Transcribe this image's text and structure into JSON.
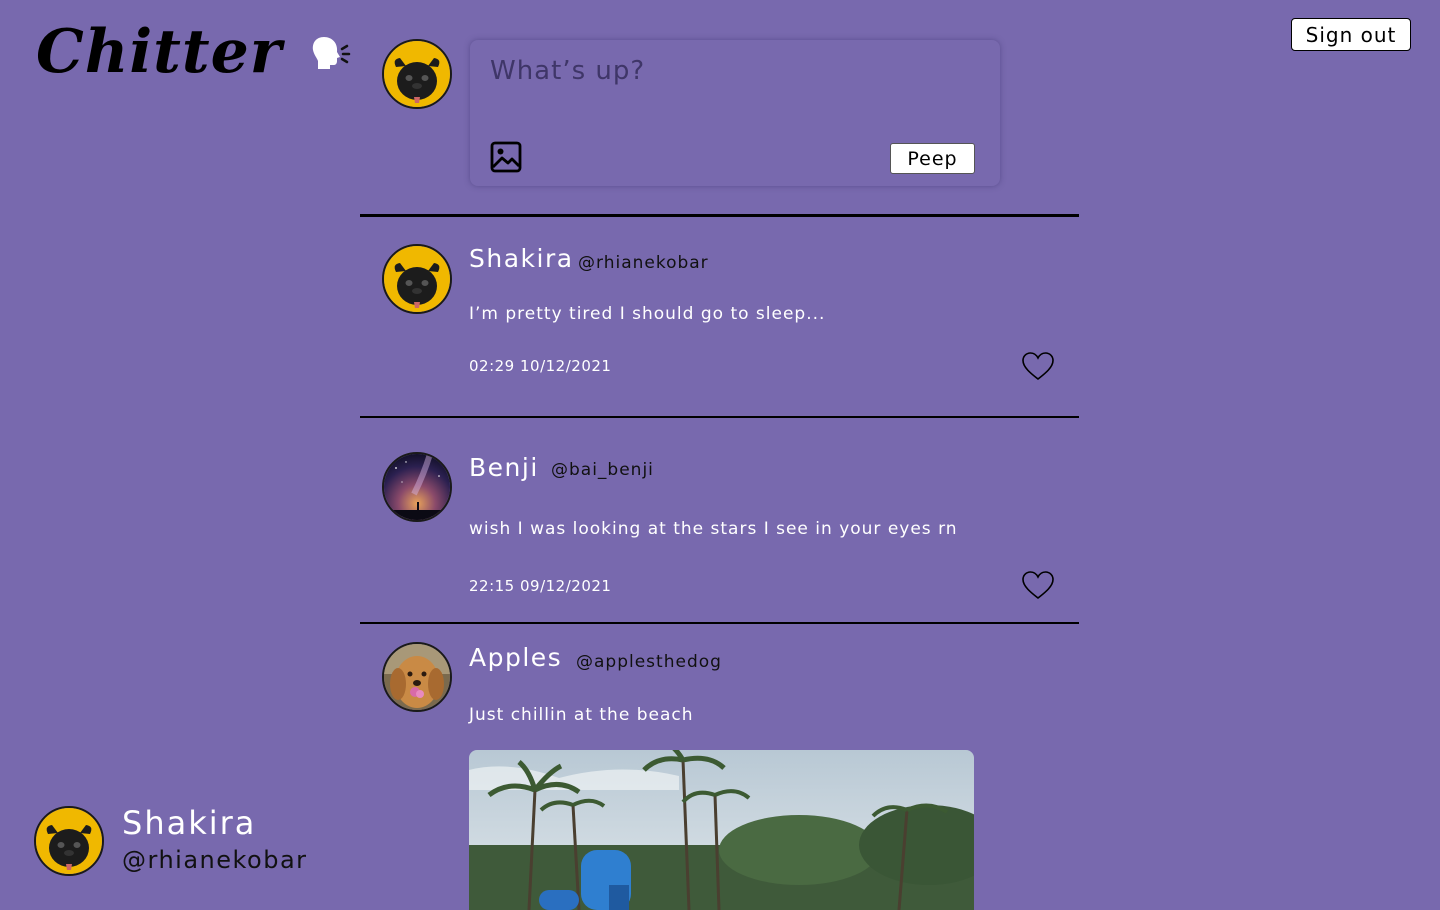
{
  "app": {
    "logo_text": "Chitter"
  },
  "header": {
    "sign_out_label": "Sign out"
  },
  "compose": {
    "placeholder": "What’s up?",
    "submit_label": "Peep"
  },
  "posts": [
    {
      "name": "Shakira",
      "handle": "@rhianekobar",
      "text": "I’m pretty tired I should go to sleep...",
      "time": "02:29 10/12/2021",
      "avatar": "pug"
    },
    {
      "name": "Benji",
      "handle": "@bai_benji",
      "text": "wish I was looking at the stars I see in  your eyes rn",
      "time": "22:15 09/12/2021",
      "avatar": "night-sky"
    },
    {
      "name": "Apples",
      "handle": "@applesthedog",
      "text": "Just chillin at the beach",
      "time": "",
      "avatar": "golden-dog",
      "has_image": true
    }
  ],
  "current_user": {
    "name": "Shakira",
    "handle": "@rhianekobar",
    "avatar": "pug"
  },
  "colors": {
    "background": "#7869AE",
    "pug_avatar_bg": "#F0B800"
  }
}
